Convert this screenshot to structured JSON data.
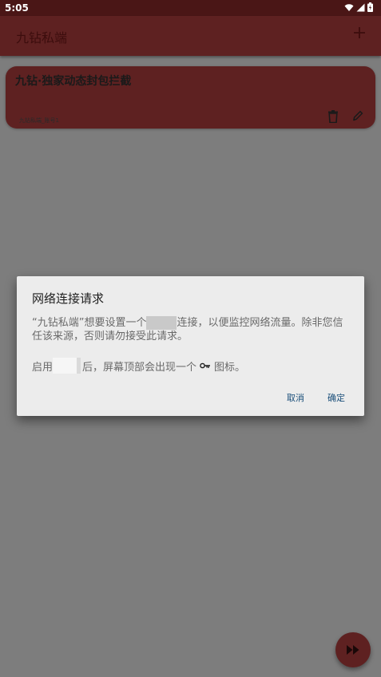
{
  "status_bar": {
    "time": "5:05"
  },
  "app_bar": {
    "title": "九钻私端"
  },
  "card": {
    "title": "九钻·独家动态封包拦截",
    "subtitle": "九钻私端_账号1"
  },
  "dialog": {
    "title": "网络连接请求",
    "body1_a": "“九钻私端”想要设置一个",
    "body1_b": "连接，以便监控网络流量。除非您信任该来源，否则请勿接受此请求。",
    "body2_a": "启用",
    "body2_b": "后，屏幕顶部会出现一个",
    "body2_c": "图标。",
    "cancel_label": "取消",
    "ok_label": "确定"
  },
  "colors": {
    "status_bar": "#4a1616",
    "app_bar": "#5e2121",
    "scrim_background": "#7d7d7d",
    "dialog_bg": "#ececec",
    "button_text": "#1b4f7a"
  }
}
